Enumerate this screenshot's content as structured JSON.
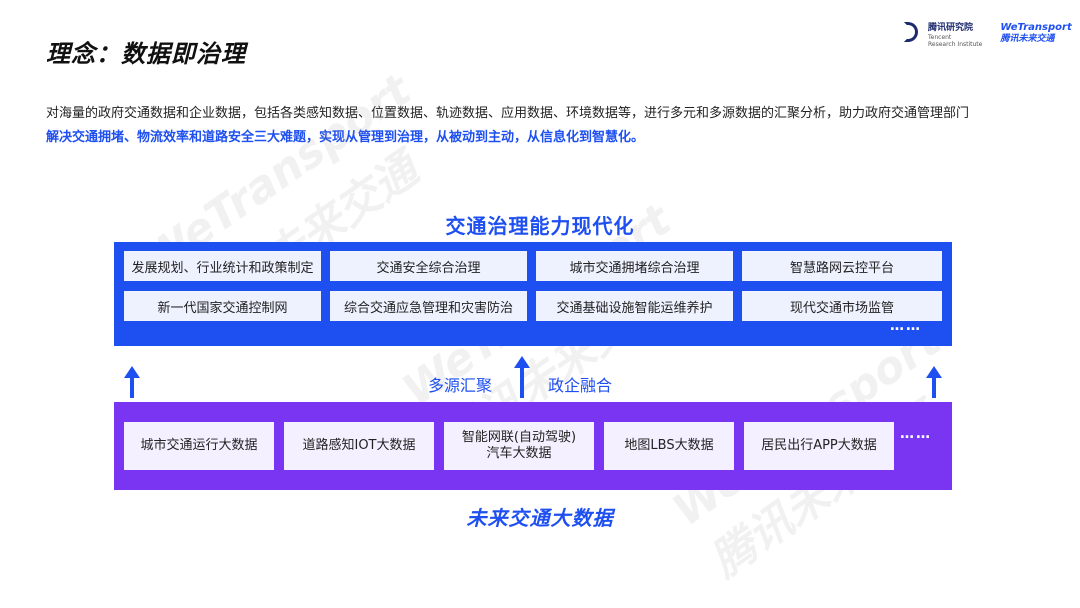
{
  "header": {
    "title": "理念：数据即治理",
    "logo_tencent": {
      "main": "腾讯研究院",
      "sub_en1": "Tencent",
      "sub_en2": "Research Institute"
    },
    "logo_wetransport": {
      "en": "WeTransport",
      "cn": "腾讯未来交通"
    }
  },
  "description": {
    "line1": "对海量的政府交通数据和企业数据，包括各类感知数据、位置数据、轨迹数据、应用数据、环境数据等，进行多元和多源数据的汇聚分析，助力政府交通管理部门",
    "line2": "解决交通拥堵、物流效率和道路安全三大难题，实现从管理到治理，从被动到主动，从信息化到智慧化。"
  },
  "watermarks": [
    "WeTransport",
    "腾讯未来交通"
  ],
  "top_section": {
    "title": "交通治理能力现代化",
    "row1": [
      "发展规划、行业统计和政策制定",
      "交通安全综合治理",
      "城市交通拥堵综合治理",
      "智慧路网云控平台"
    ],
    "row2": [
      "新一代国家交通控制网",
      "综合交通应急管理和灾害防治",
      "交通基础设施智能运维养护",
      "现代交通市场监管"
    ],
    "more": "……"
  },
  "middle": {
    "left_label": "多源汇聚",
    "right_label": "政企融合"
  },
  "bottom_section": {
    "items": [
      {
        "line1": "城市交通运行大数据",
        "line2": ""
      },
      {
        "line1": "道路感知IOT大数据",
        "line2": ""
      },
      {
        "line1": "智能网联(自动驾驶)",
        "line2": "汽车大数据"
      },
      {
        "line1": "地图LBS大数据",
        "line2": ""
      },
      {
        "line1": "居民出行APP大数据",
        "line2": ""
      }
    ],
    "more": "……",
    "title": "未来交通大数据"
  },
  "colors": {
    "accent_blue": "#1e4ff0",
    "accent_purple": "#7a35f2"
  }
}
